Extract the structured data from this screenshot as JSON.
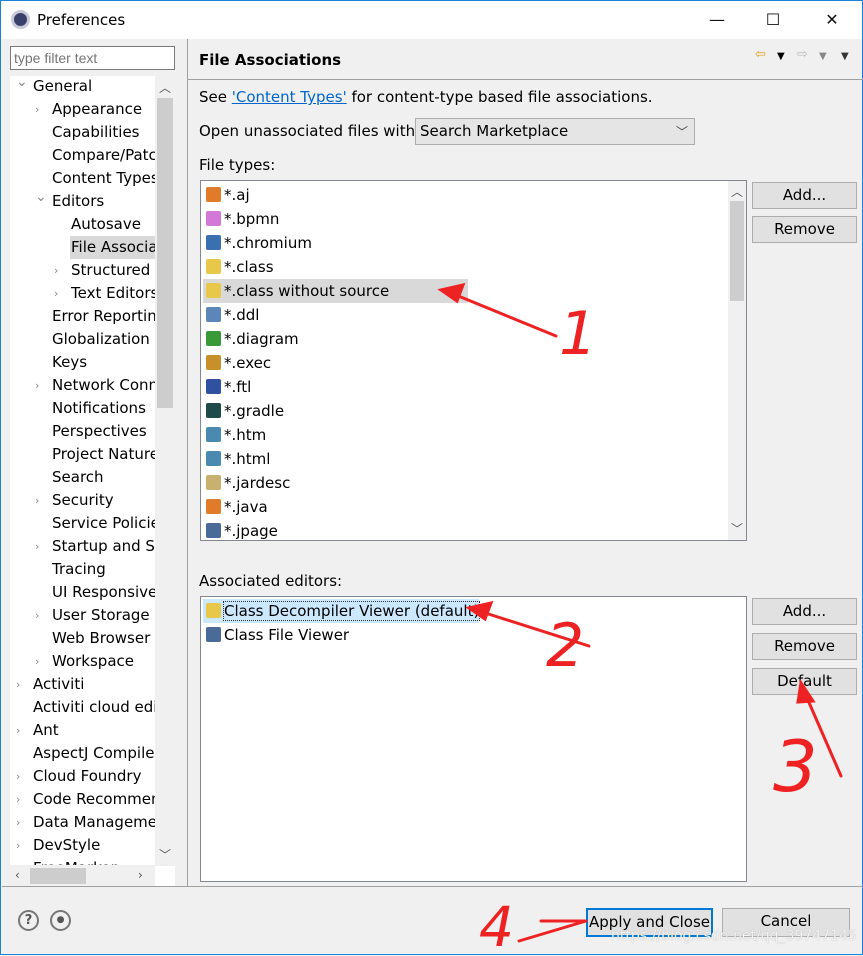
{
  "window": {
    "title": "Preferences",
    "minimize": "—",
    "maximize": "☐",
    "close": "✕"
  },
  "filter": {
    "placeholder": "type filter text"
  },
  "tree": [
    {
      "label": "General",
      "level": 0,
      "twisty": "open"
    },
    {
      "label": "Appearance",
      "level": 1,
      "twisty": "closed"
    },
    {
      "label": "Capabilities",
      "level": 1
    },
    {
      "label": "Compare/Patch",
      "level": 1
    },
    {
      "label": "Content Types",
      "level": 1
    },
    {
      "label": "Editors",
      "level": 1,
      "twisty": "open"
    },
    {
      "label": "Autosave",
      "level": 2
    },
    {
      "label": "File Associations",
      "level": 2,
      "selected": true
    },
    {
      "label": "Structured Text Editors",
      "level": 2,
      "twisty": "closed"
    },
    {
      "label": "Text Editors",
      "level": 2,
      "twisty": "closed"
    },
    {
      "label": "Error Reporting",
      "level": 1
    },
    {
      "label": "Globalization",
      "level": 1
    },
    {
      "label": "Keys",
      "level": 1
    },
    {
      "label": "Network Connections",
      "level": 1,
      "twisty": "closed"
    },
    {
      "label": "Notifications",
      "level": 1
    },
    {
      "label": "Perspectives",
      "level": 1
    },
    {
      "label": "Project Natures",
      "level": 1
    },
    {
      "label": "Search",
      "level": 1
    },
    {
      "label": "Security",
      "level": 1,
      "twisty": "closed"
    },
    {
      "label": "Service Policies",
      "level": 1
    },
    {
      "label": "Startup and Shutdown",
      "level": 1,
      "twisty": "closed"
    },
    {
      "label": "Tracing",
      "level": 1
    },
    {
      "label": "UI Responsiveness",
      "level": 1
    },
    {
      "label": "User Storage Service",
      "level": 1,
      "twisty": "closed"
    },
    {
      "label": "Web Browser",
      "level": 1
    },
    {
      "label": "Workspace",
      "level": 1,
      "twisty": "closed"
    },
    {
      "label": "Activiti",
      "level": 0,
      "twisty": "closed"
    },
    {
      "label": "Activiti cloud editor",
      "level": 0
    },
    {
      "label": "Ant",
      "level": 0,
      "twisty": "closed"
    },
    {
      "label": "AspectJ Compiler",
      "level": 0
    },
    {
      "label": "Cloud Foundry",
      "level": 0,
      "twisty": "closed"
    },
    {
      "label": "Code Recommenders",
      "level": 0,
      "twisty": "closed"
    },
    {
      "label": "Data Management",
      "level": 0,
      "twisty": "closed"
    },
    {
      "label": "DevStyle",
      "level": 0,
      "twisty": "closed"
    },
    {
      "label": "FreeMarker",
      "level": 0,
      "twisty": "closed"
    }
  ],
  "page": {
    "title": "File Associations",
    "see_prefix": "See ",
    "see_link": "'Content Types'",
    "see_suffix": " for content-type based file associations.",
    "open_label": "Open unassociated files with:",
    "open_value": "Search Marketplace",
    "file_types_label": "File types:",
    "assoc_label": "Associated editors:"
  },
  "file_types": [
    {
      "label": "*.aj",
      "icon": "aspectj-file-icon",
      "color": "#e07b2a"
    },
    {
      "label": "*.bpmn",
      "icon": "bpmn-icon",
      "color": "#d478d8"
    },
    {
      "label": "*.chromium",
      "icon": "chromium-icon",
      "color": "#3a6fb0"
    },
    {
      "label": "*.class",
      "icon": "class-file-icon",
      "color": "#e8c84a"
    },
    {
      "label": "*.class without source",
      "icon": "class-file-icon",
      "color": "#e8c84a",
      "selected": true
    },
    {
      "label": "*.ddl",
      "icon": "ddl-icon",
      "color": "#5d86b8"
    },
    {
      "label": "*.diagram",
      "icon": "diagram-icon",
      "color": "#3a9a3a"
    },
    {
      "label": "*.exec",
      "icon": "gears-icon",
      "color": "#c8902a"
    },
    {
      "label": "*.ftl",
      "icon": "freemarker-icon",
      "color": "#3050a0"
    },
    {
      "label": "*.gradle",
      "icon": "gradle-icon",
      "color": "#1f4a4a"
    },
    {
      "label": "*.htm",
      "icon": "globe-icon",
      "color": "#4a8ab0"
    },
    {
      "label": "*.html",
      "icon": "globe-icon",
      "color": "#4a8ab0"
    },
    {
      "label": "*.jardesc",
      "icon": "jar-icon",
      "color": "#c8b070"
    },
    {
      "label": "*.java",
      "icon": "java-file-icon",
      "color": "#e07b2a"
    },
    {
      "label": "*.jpage",
      "icon": "jpage-icon",
      "color": "#4a6a9a"
    }
  ],
  "editors": [
    {
      "label": "Class Decompiler Viewer (default)",
      "icon": "class-decompiler-icon",
      "color": "#e8c84a",
      "selected": true
    },
    {
      "label": "Class File Viewer",
      "icon": "class-file-viewer-icon",
      "color": "#4a6a9a"
    }
  ],
  "buttons": {
    "add": "Add...",
    "remove": "Remove",
    "add2": "Add...",
    "remove2": "Remove",
    "default": "Default",
    "apply_close": "Apply and Close",
    "cancel": "Cancel"
  },
  "footer": {
    "help": "?"
  },
  "annotations": {
    "n1": "1",
    "n2": "2",
    "n3": "3",
    "n4": "4",
    "color": "#ee2222"
  },
  "watermark": "https://blog.csdn.net/qq_39747145"
}
